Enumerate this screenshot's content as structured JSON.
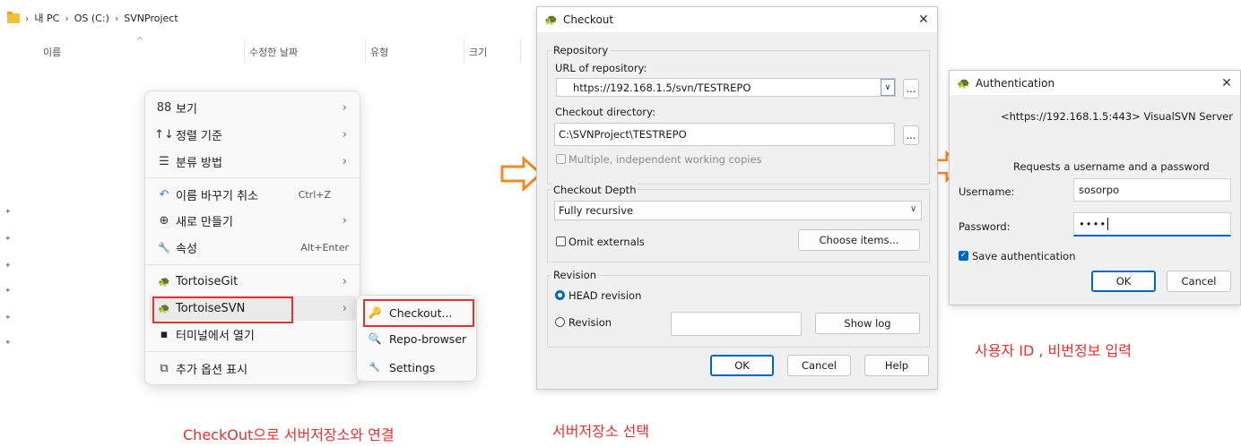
{
  "explorer": {
    "breadcrumb": [
      "내 PC",
      "OS (C:)",
      "SVNProject"
    ],
    "columns": [
      "이름",
      "수정한 날짜",
      "유형",
      "크기"
    ]
  },
  "context_menu": {
    "items": [
      {
        "label": "보기",
        "icon": "grid-icon",
        "glyph": "88",
        "submenu": true
      },
      {
        "label": "정렬 기준",
        "icon": "sort-icon",
        "glyph": "↑↓",
        "submenu": true
      },
      {
        "label": "분류 방법",
        "icon": "group-icon",
        "glyph": "☰",
        "submenu": true
      },
      {
        "label": "이름 바꾸기 취소",
        "icon": "undo-icon",
        "glyph": "↶",
        "shortcut": "Ctrl+Z"
      },
      {
        "label": "새로 만들기",
        "icon": "new-icon",
        "glyph": "⊕",
        "submenu": true
      },
      {
        "label": "속성",
        "icon": "properties-icon",
        "glyph": "🔧",
        "shortcut": "Alt+Enter"
      },
      {
        "label": "TortoiseGit",
        "icon": "tortoise-icon",
        "glyph": "🐢",
        "submenu": true
      },
      {
        "label": "TortoiseSVN",
        "icon": "tortoise-icon",
        "glyph": "🐢",
        "submenu": true
      },
      {
        "label": "터미널에서 열기",
        "icon": "terminal-icon",
        "glyph": "▪"
      },
      {
        "label": "추가 옵션 표시",
        "icon": "more-options-icon",
        "glyph": "⧉"
      }
    ]
  },
  "submenu": {
    "items": [
      {
        "label": "Checkout...",
        "icon": "checkout-icon",
        "glyph": "🔑"
      },
      {
        "label": "Repo-browser",
        "icon": "repo-browser-icon",
        "glyph": "🔍"
      },
      {
        "label": "Settings",
        "icon": "settings-icon",
        "glyph": "🔧"
      }
    ]
  },
  "captions": {
    "left": "CheckOut으로 서버저장소와 연결",
    "middle": "서버저장소 선택",
    "right": "사용자 ID , 비번정보 입력"
  },
  "checkout": {
    "title": "Checkout",
    "close": "✕",
    "repository_group": "Repository",
    "url_label": "URL of repository:",
    "url_value": "https://192.168.1.5/svn/TESTREPO",
    "dir_label": "Checkout directory:",
    "dir_value": "C:\\SVNProject\\TESTREPO",
    "browse": "...",
    "multiple_label": "Multiple, independent working copies",
    "depth_group": "Checkout Depth",
    "depth_value": "Fully recursive",
    "omit_label": "Omit externals",
    "choose_items": "Choose items...",
    "revision_group": "Revision",
    "head_revision": "HEAD revision",
    "revision": "Revision",
    "show_log": "Show log",
    "ok": "OK",
    "cancel": "Cancel",
    "help": "Help"
  },
  "auth": {
    "title": "Authentication",
    "close": "✕",
    "realm": "<https://192.168.1.5:443> VisualSVN Server",
    "prompt": "Requests a username and a password",
    "username_label": "Username:",
    "username_value": "sosorpo",
    "password_label": "Password:",
    "password_value": "••••",
    "save_label": "Save authentication",
    "ok": "OK",
    "cancel": "Cancel"
  },
  "colors": {
    "highlight_red": "#e5302f",
    "arrow_orange": "#f08a24",
    "accent_blue": "#0067c0"
  }
}
